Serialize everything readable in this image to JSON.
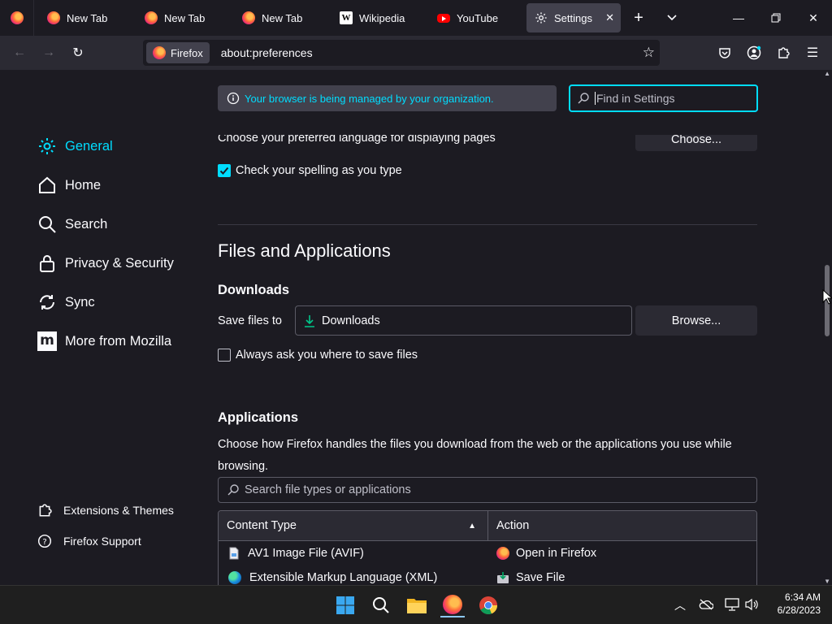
{
  "tabs": [
    {
      "label": "New Tab",
      "icon": "firefox-icon"
    },
    {
      "label": "New Tab",
      "icon": "firefox-icon"
    },
    {
      "label": "New Tab",
      "icon": "firefox-icon"
    },
    {
      "label": "Wikipedia",
      "icon": "wikipedia-icon",
      "glyph": "W"
    },
    {
      "label": "YouTube",
      "icon": "youtube-icon"
    },
    {
      "label": "Settings",
      "icon": "gear-icon",
      "active": true
    }
  ],
  "navbar": {
    "identity_label": "Firefox",
    "url": "about:preferences"
  },
  "sidebar": {
    "categories": [
      {
        "label": "General",
        "icon": "gear-icon",
        "selected": true
      },
      {
        "label": "Home",
        "icon": "home-icon"
      },
      {
        "label": "Search",
        "icon": "search-icon"
      },
      {
        "label": "Privacy & Security",
        "icon": "lock-icon"
      },
      {
        "label": "Sync",
        "icon": "sync-icon"
      },
      {
        "label": "More from Mozilla",
        "icon": "mozilla-icon",
        "glyph": "m"
      }
    ],
    "footer": [
      {
        "label": "Extensions & Themes",
        "icon": "puzzle-icon"
      },
      {
        "label": "Firefox Support",
        "icon": "help-icon"
      }
    ]
  },
  "managed_notice": "Your browser is being managed by your organization.",
  "find_placeholder": "Find in Settings",
  "language": {
    "description": "Choose your preferred language for displaying pages",
    "button_label": "Choose..."
  },
  "spellcheck": {
    "label": "Check your spelling as you type",
    "checked": true
  },
  "files_section": {
    "title": "Files and Applications",
    "downloads_heading": "Downloads",
    "save_label": "Save files to",
    "save_folder": "Downloads",
    "browse_label": "Browse...",
    "always_ask_label": "Always ask you where to save files",
    "always_ask_checked": false
  },
  "applications": {
    "heading": "Applications",
    "description": "Choose how Firefox handles the files you download from the web or the applications you use while browsing.",
    "search_placeholder": "Search file types or applications",
    "columns": [
      "Content Type",
      "Action"
    ],
    "rows": [
      {
        "type": "AV1 Image File (AVIF)",
        "type_icon": "file-icon",
        "action": "Open in Firefox",
        "action_icon": "firefox-icon"
      },
      {
        "type": "Extensible Markup Language (XML)",
        "type_icon": "edge-icon",
        "action": "Save File",
        "action_icon": "save-file-icon"
      }
    ]
  },
  "taskbar": {
    "time": "6:34 AM",
    "date": "6/28/2023"
  },
  "colors": {
    "accent": "#00ddff",
    "background": "#1c1b22",
    "surface": "#2b2a33"
  }
}
